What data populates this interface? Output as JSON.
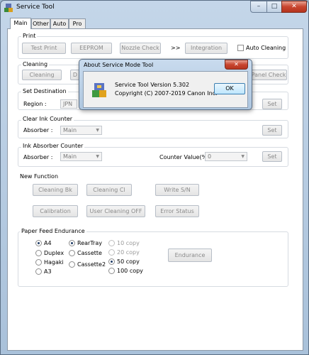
{
  "window": {
    "title": "Service Tool",
    "controls": {
      "minimize": "–",
      "maximize": "□",
      "close": "✕"
    }
  },
  "tabs": [
    "Main",
    "Other",
    "Auto",
    "Pro"
  ],
  "print": {
    "label": "Print",
    "test_print": "Test Print",
    "eeprom": "EEPROM",
    "nozzle_check": "Nozzle Check",
    "arrow": ">>",
    "integration": "Integration",
    "auto_cleaning": "Auto Cleaning"
  },
  "cleaning": {
    "label": "Cleaning",
    "cleaning_btn": "Cleaning",
    "deep_btn": "D",
    "hidden_text": "Counter Value(%)",
    "panel_check": "Panel Check"
  },
  "set_destination": {
    "label": "Set Destination",
    "region_label": "Region :",
    "region_value": "JPN",
    "set": "Set"
  },
  "clear_ink": {
    "label": "Clear Ink Counter",
    "absorber_label": "Absorber :",
    "absorber_value": "Main",
    "set": "Set"
  },
  "ink_absorber": {
    "label": "Ink Absorber Counter",
    "absorber_label": "Absorber :",
    "absorber_value": "Main",
    "counter_label": "Counter Value(%) :",
    "counter_value": "0",
    "set": "Set"
  },
  "new_function": {
    "label": "New Function",
    "cleaning_bk": "Cleaning Bk",
    "cleaning_cl": "Cleaning Cl",
    "write_sn": "Write S/N",
    "calibration": "Calibration",
    "user_cleaning_off": "User Cleaning OFF",
    "error_status": "Error Status"
  },
  "paper_feed": {
    "label": "Paper Feed Endurance",
    "sizes": [
      "A4",
      "Duplex",
      "Hagaki",
      "A3"
    ],
    "trays": [
      "RearTray",
      "Cassette",
      "Cassette2"
    ],
    "copies": [
      "10 copy",
      "20 copy",
      "50 copy",
      "100 copy"
    ],
    "selected_size": "A4",
    "selected_tray": "RearTray",
    "selected_copy": "50 copy",
    "endurance": "Endurance"
  },
  "dialog": {
    "title": "About Service Mode Tool",
    "close": "✕",
    "version": "Service Tool Version 5.302",
    "copyright": "Copyright (C) 2007-2019 Canon Inc.",
    "ok": "OK"
  },
  "colors": {
    "titlebar": "#b7cce2",
    "close_button": "#c8452f",
    "panel_bg": "#ffffff",
    "disabled_text": "#8a8a8a"
  }
}
